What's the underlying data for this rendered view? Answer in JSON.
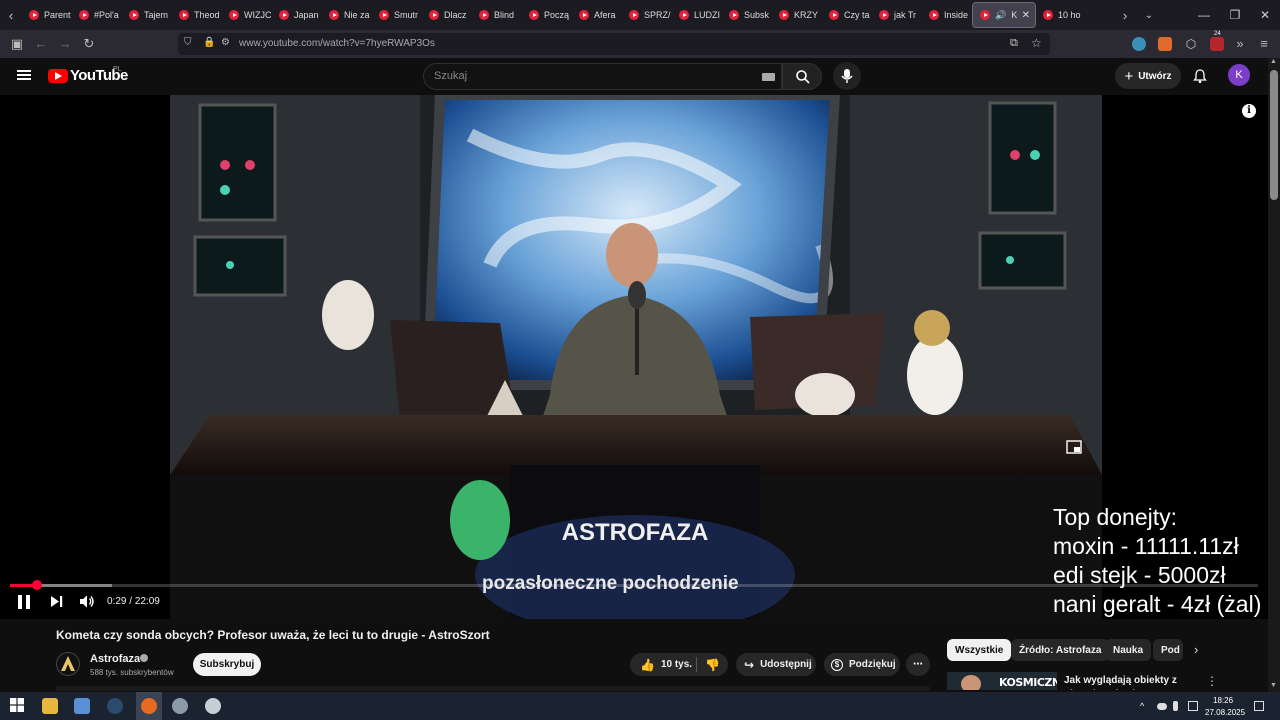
{
  "browser": {
    "tabs": [
      {
        "label": "Parent"
      },
      {
        "label": "#Pol'a"
      },
      {
        "label": "Tajem"
      },
      {
        "label": "Theod"
      },
      {
        "label": "WIZJC"
      },
      {
        "label": "Japan"
      },
      {
        "label": "Nie za"
      },
      {
        "label": "Smutr"
      },
      {
        "label": "Dlacz"
      },
      {
        "label": "Blind"
      },
      {
        "label": "Począ"
      },
      {
        "label": "Afera"
      },
      {
        "label": "SPRZ/"
      },
      {
        "label": "LUDZI"
      },
      {
        "label": "Subsk"
      },
      {
        "label": "KRZY"
      },
      {
        "label": "Czy ta"
      },
      {
        "label": "jak Tr"
      },
      {
        "label": "Inside"
      }
    ],
    "active_tab": {
      "label": "Kor"
    },
    "after_tab": {
      "label": "10 ho"
    },
    "url": "www.youtube.com/watch?v=7hyeRWAP3Os",
    "ext_badge": "24"
  },
  "youtube": {
    "logo_text": "YouTube",
    "region": "PL",
    "search_placeholder": "Szukaj",
    "create_label": "Utwórz",
    "avatar_letter": "K"
  },
  "player": {
    "subtitle": "pozasłoneczne pochodzenie",
    "current_time": "0:29",
    "duration": "22:09",
    "played_fraction": 0.022,
    "loaded_fraction": 0.082,
    "overlay_logo": "ASTROFAZA",
    "donations": {
      "heading": "Top donejty:",
      "lines": [
        "moxin - 11111.11zł",
        "edi stejk - 5000zł",
        "nani geralt - 4zł (żal)"
      ]
    }
  },
  "video": {
    "title": "Kometa czy sonda obcych? Profesor uważa, że leci tu to drugie - AstroSzort",
    "channel": "Astrofaza",
    "subscribers": "588 tys. subskrybentów",
    "subscribe_label": "Subskrybuj",
    "likes": "10 tys.",
    "share_label": "Udostępnij",
    "thanks_label": "Podziękuj"
  },
  "sidebar": {
    "chips": [
      {
        "label": "Wszystkie",
        "active": true
      },
      {
        "label": "Źródło: Astrofaza",
        "active": false
      },
      {
        "label": "Nauka",
        "active": false
      },
      {
        "label": "Pod",
        "active": false
      }
    ],
    "rec_thumb_text": "KOSMICZNI",
    "rec_title": "Jak wyglądają obiekty z obcych gwiazd?"
  },
  "taskbar": {
    "time": "18:26",
    "date": "27.08.2025"
  },
  "colors": {
    "yt_red": "#ff0000",
    "progress_red": "#ff0033",
    "background": "#0f0f0f"
  }
}
